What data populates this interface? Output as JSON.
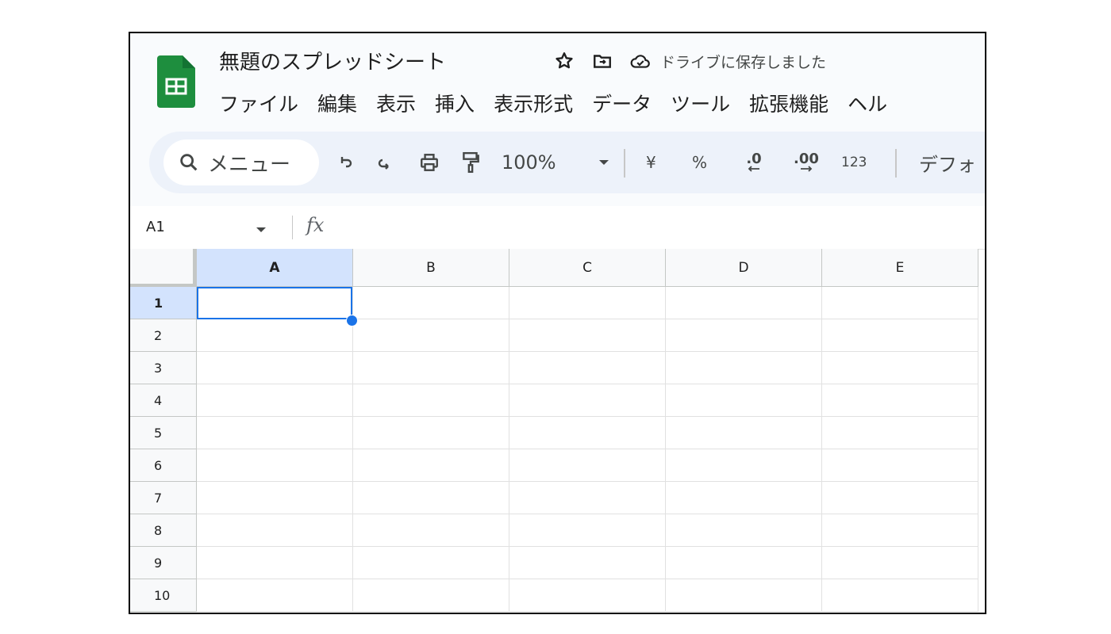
{
  "doc": {
    "title": "無題のスプレッドシート",
    "save_status": "ドライブに保存しました"
  },
  "menu": [
    "ファイル",
    "編集",
    "表示",
    "挿入",
    "表示形式",
    "データ",
    "ツール",
    "拡張機能",
    "ヘル"
  ],
  "toolbar": {
    "search_label": "メニュー",
    "zoom": "100%",
    "currency": "¥",
    "percent": "%",
    "decrease_decimal": ".0",
    "increase_decimal": ".00",
    "number_format": "123",
    "font": "デフォ"
  },
  "formula_bar": {
    "cell_ref": "A1",
    "fx": "fx"
  },
  "sheet": {
    "columns": [
      "A",
      "B",
      "C",
      "D",
      "E"
    ],
    "rows": [
      "1",
      "2",
      "3",
      "4",
      "5",
      "6",
      "7",
      "8",
      "9",
      "10"
    ],
    "selected_cell": "A1"
  },
  "colors": {
    "accent": "#1a73e8",
    "logo_green": "#1e8e3e",
    "selected_header": "#d3e3fd",
    "toolbar_bg": "#edf2fa"
  },
  "icons": [
    "sheets-logo-icon",
    "star-icon",
    "move-folder-icon",
    "cloud-saved-icon",
    "search-icon",
    "undo-icon",
    "redo-icon",
    "print-icon",
    "paint-format-icon",
    "chevron-down-icon"
  ]
}
